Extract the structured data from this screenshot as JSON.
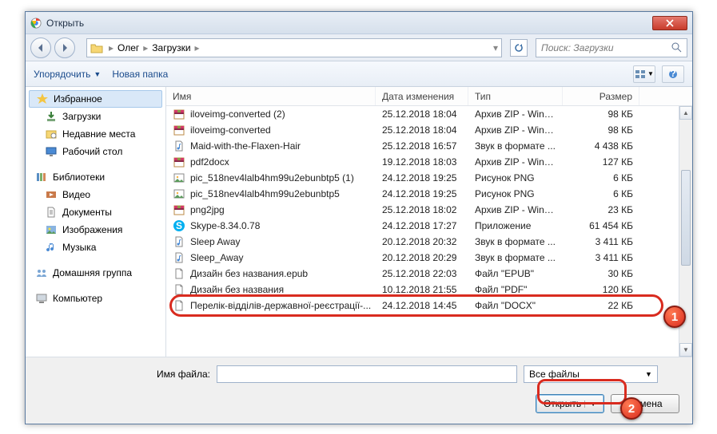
{
  "window_title": "Открыть",
  "breadcrumb": {
    "parts": [
      "Олег",
      "Загрузки"
    ]
  },
  "search_placeholder": "Поиск: Загрузки",
  "toolbar": {
    "organize": "Упорядочить",
    "new_folder": "Новая папка"
  },
  "sidebar": {
    "favorites": "Избранное",
    "downloads": "Загрузки",
    "recent": "Недавние места",
    "desktop": "Рабочий стол",
    "libraries": "Библиотеки",
    "videos": "Видео",
    "documents": "Документы",
    "pictures": "Изображения",
    "music": "Музыка",
    "homegroup": "Домашняя группа",
    "computer": "Компьютер"
  },
  "columns": {
    "name": "Имя",
    "date": "Дата изменения",
    "type": "Тип",
    "size": "Размер"
  },
  "files": [
    {
      "icon": "archive",
      "name": "iloveimg-converted (2)",
      "date": "25.12.2018 18:04",
      "type": "Архив ZIP - WinR...",
      "size": "98 КБ"
    },
    {
      "icon": "archive",
      "name": "iloveimg-converted",
      "date": "25.12.2018 18:04",
      "type": "Архив ZIP - WinR...",
      "size": "98 КБ"
    },
    {
      "icon": "audio",
      "name": "Maid-with-the-Flaxen-Hair",
      "date": "25.12.2018 16:57",
      "type": "Звук в формате ...",
      "size": "4 438 КБ"
    },
    {
      "icon": "archive",
      "name": "pdf2docx",
      "date": "19.12.2018 18:03",
      "type": "Архив ZIP - WinR...",
      "size": "127 КБ"
    },
    {
      "icon": "image",
      "name": "pic_518nev4lalb4hm99u2ebunbtp5 (1)",
      "date": "24.12.2018 19:25",
      "type": "Рисунок PNG",
      "size": "6 КБ"
    },
    {
      "icon": "image",
      "name": "pic_518nev4lalb4hm99u2ebunbtp5",
      "date": "24.12.2018 19:25",
      "type": "Рисунок PNG",
      "size": "6 КБ"
    },
    {
      "icon": "archive",
      "name": "png2jpg",
      "date": "25.12.2018 18:02",
      "type": "Архив ZIP - WinR...",
      "size": "23 КБ"
    },
    {
      "icon": "skype",
      "name": "Skype-8.34.0.78",
      "date": "24.12.2018 17:27",
      "type": "Приложение",
      "size": "61 454 КБ"
    },
    {
      "icon": "audio",
      "name": "Sleep Away",
      "date": "20.12.2018 20:32",
      "type": "Звук в формате ...",
      "size": "3 411 КБ"
    },
    {
      "icon": "audio",
      "name": "Sleep_Away",
      "date": "20.12.2018 20:29",
      "type": "Звук в формате ...",
      "size": "3 411 КБ"
    },
    {
      "icon": "doc",
      "name": "Дизайн без названия.epub",
      "date": "25.12.2018 22:03",
      "type": "Файл \"EPUB\"",
      "size": "30 КБ"
    },
    {
      "icon": "doc",
      "name": "Дизайн без названия",
      "date": "10.12.2018 21:55",
      "type": "Файл \"PDF\"",
      "size": "120 КБ"
    },
    {
      "icon": "doc",
      "name": "Перелік-відділів-державної-реєстрації-...",
      "date": "24.12.2018 14:45",
      "type": "Файл \"DOCX\"",
      "size": "22 КБ"
    }
  ],
  "footer": {
    "filename_label": "Имя файла:",
    "filename_value": "",
    "filter": "Все файлы",
    "open": "Открыть",
    "cancel": "Отмена"
  },
  "markers": {
    "m1": "1",
    "m2": "2"
  }
}
